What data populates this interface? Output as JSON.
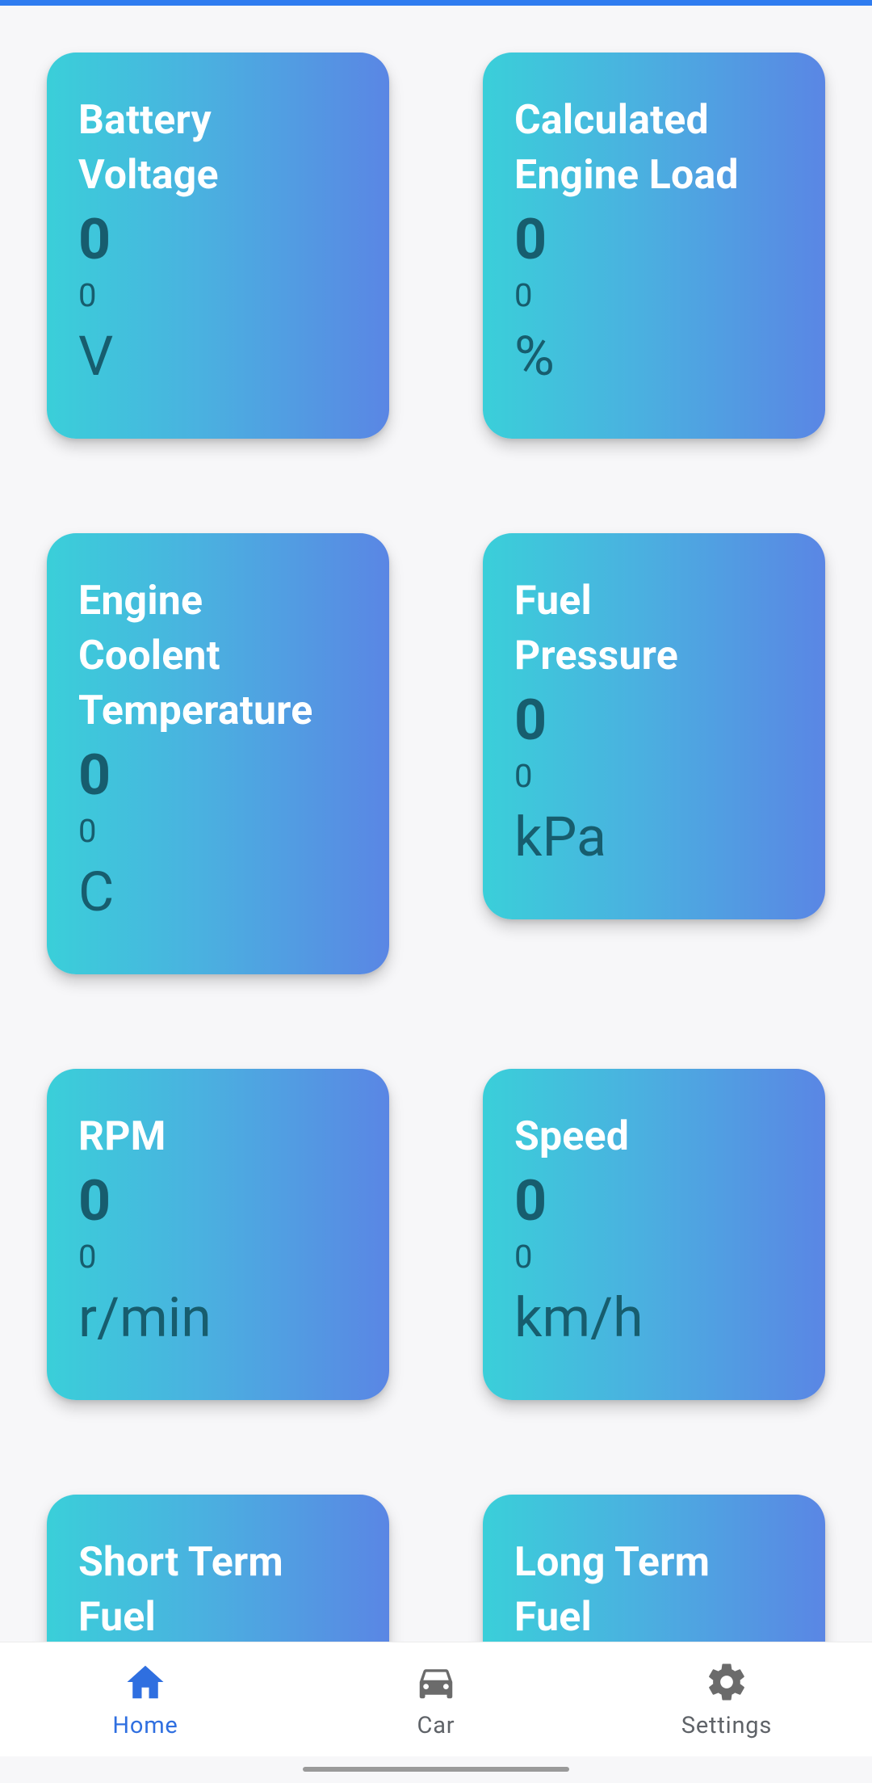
{
  "cards": [
    {
      "title": "Battery Voltage",
      "value": "0",
      "sub": "0",
      "unit": "V"
    },
    {
      "title": "Calculated Engine Load",
      "value": "0",
      "sub": "0",
      "unit": "%"
    },
    {
      "title": "Engine Coolent Temperature",
      "value": "0",
      "sub": "0",
      "unit": "C"
    },
    {
      "title": "Fuel Pressure",
      "value": "0",
      "sub": "0",
      "unit": "kPa"
    },
    {
      "title": "RPM",
      "value": "0",
      "sub": "0",
      "unit": "r/min"
    },
    {
      "title": "Speed",
      "value": "0",
      "sub": "0",
      "unit": "km/h"
    },
    {
      "title": "Short Term Fuel",
      "value": "",
      "sub": "",
      "unit": ""
    },
    {
      "title": "Long Term Fuel",
      "value": "",
      "sub": "",
      "unit": ""
    }
  ],
  "nav": {
    "items": [
      {
        "label": "Home",
        "icon": "home-icon",
        "active": true
      },
      {
        "label": "Car",
        "icon": "car-icon",
        "active": false
      },
      {
        "label": "Settings",
        "icon": "gear-icon",
        "active": false
      }
    ]
  },
  "colors": {
    "accent": "#2f7cf0",
    "card_gradient_start": "#3acfd9",
    "card_gradient_end": "#5a86e4",
    "value_text": "#175d6e",
    "title_text": "#ffffff"
  }
}
